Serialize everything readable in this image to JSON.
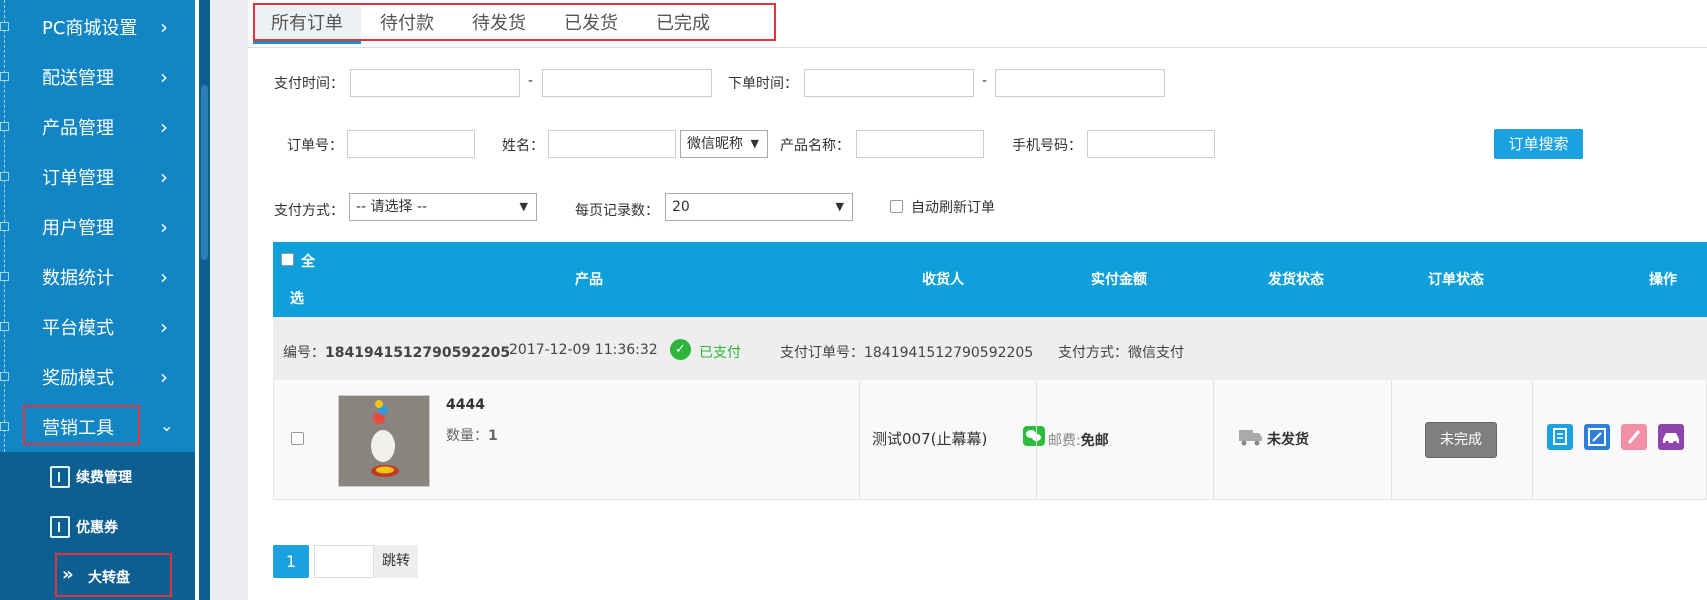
{
  "sidebar": {
    "items": [
      {
        "label": "PC商城设置"
      },
      {
        "label": "配送管理"
      },
      {
        "label": "产品管理"
      },
      {
        "label": "订单管理"
      },
      {
        "label": "用户管理"
      },
      {
        "label": "数据统计"
      },
      {
        "label": "平台模式"
      },
      {
        "label": "奖励模式"
      },
      {
        "label": "营销工具"
      }
    ],
    "sub_items": [
      {
        "label": "续费管理"
      },
      {
        "label": "优惠券"
      },
      {
        "label": "大转盘"
      }
    ]
  },
  "tabs": [
    {
      "label": "所有订单"
    },
    {
      "label": "待付款"
    },
    {
      "label": "待发货"
    },
    {
      "label": "已发货"
    },
    {
      "label": "已完成"
    }
  ],
  "filters": {
    "pay_time_label": "支付时间：",
    "order_time_label": "下单时间：",
    "dash": "-",
    "order_no_label": "订单号：",
    "name_label": "姓名：",
    "name_type_select": "微信昵称",
    "product_name_label": "产品名称：",
    "phone_label": "手机号码：",
    "search_button": "订单搜索",
    "pay_method_label": "支付方式：",
    "pay_method_select": "-- 请选择 --",
    "per_page_label": "每页记录数：",
    "per_page_select": "20",
    "auto_refresh_label": "自动刷新订单"
  },
  "table": {
    "select_all_1": "全",
    "select_all_2": "选",
    "headers": {
      "product": "产品",
      "receiver": "收货人",
      "amount": "实付金额",
      "ship_status": "发货状态",
      "order_status": "订单状态",
      "actions": "操作"
    }
  },
  "order": {
    "no_label": "编号：",
    "no": "1841941512790592205",
    "time": "2017-12-09 11:36:32",
    "paid": "已支付",
    "pay_no_label": "支付订单号：",
    "pay_no": "1841941512790592205",
    "pay_method_label": "支付方式：",
    "pay_method": "微信支付",
    "product_name": "4444",
    "qty_label": "数量：",
    "qty": "1",
    "receiver": "测试007(止幕幕)",
    "shipping_label": "邮费:",
    "shipping": "免邮",
    "ship_status": "未发货",
    "order_status": "未完成"
  },
  "pager": {
    "current": "1",
    "go": "跳转"
  },
  "colors": {
    "sidebar": "#1285c4",
    "header": "#0fa0db",
    "accent": "#1aa2e0",
    "highlight": "#e0333a"
  }
}
